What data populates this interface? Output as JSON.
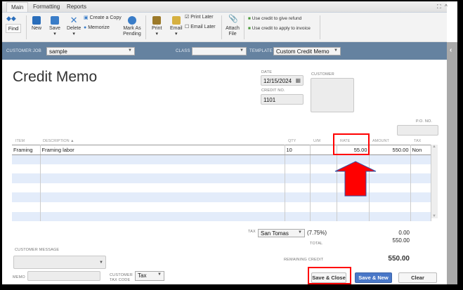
{
  "tabs": [
    "Main",
    "Formatting",
    "Reports"
  ],
  "toolbar": {
    "find": "Find",
    "new": "New",
    "save": "Save",
    "delete": "Delete",
    "create_copy": "Create a Copy",
    "memorize": "Memorize",
    "mark_pending": "Mark As Pending",
    "print": "Print",
    "email": "Email",
    "print_later": "Print Later",
    "email_later": "Email Later",
    "attach": "Attach File",
    "refund": "Use credit to give refund",
    "apply": "Use credit to apply to invoice"
  },
  "header": {
    "customer_job_label": "CUSTOMER:JOB",
    "customer_job": "sample",
    "class_label": "CLASS",
    "class_value": "",
    "template_label": "TEMPLATE",
    "template": "Custom Credit Memo"
  },
  "form": {
    "title": "Credit Memo",
    "date_label": "DATE",
    "date": "12/15/2024",
    "credit_no_label": "CREDIT NO.",
    "credit_no": "1101",
    "customer_label": "CUSTOMER",
    "po_label": "P.O. NO."
  },
  "table": {
    "columns": [
      "ITEM",
      "DESCRIPTION ▲",
      "QTY",
      "U/M",
      "RATE",
      "AMOUNT",
      "TAX"
    ],
    "rows": [
      {
        "item": "Framing",
        "description": "Framing labor",
        "qty": "10",
        "um": "",
        "rate": "55.00",
        "amount": "550.00",
        "tax": "Non"
      }
    ]
  },
  "footer": {
    "tax_label": "TAX",
    "tax_code": "San Tomas",
    "tax_rate": "(7.75%)",
    "tax_amount": "0.00",
    "total_label": "TOTAL",
    "total": "550.00",
    "remaining_label": "REMAINING CREDIT",
    "remaining": "550.00",
    "customer_message_label": "CUSTOMER MESSAGE",
    "memo_label": "MEMO",
    "cust_tax_code_label": "CUSTOMER TAX CODE",
    "cust_tax_code": "Tax",
    "save_close": "Save & Close",
    "save_new": "Save & New",
    "clear": "Clear"
  },
  "colors": {
    "bar": "#6582a0",
    "highlight": "#ff0000",
    "primary_button": "#4a78c8"
  }
}
